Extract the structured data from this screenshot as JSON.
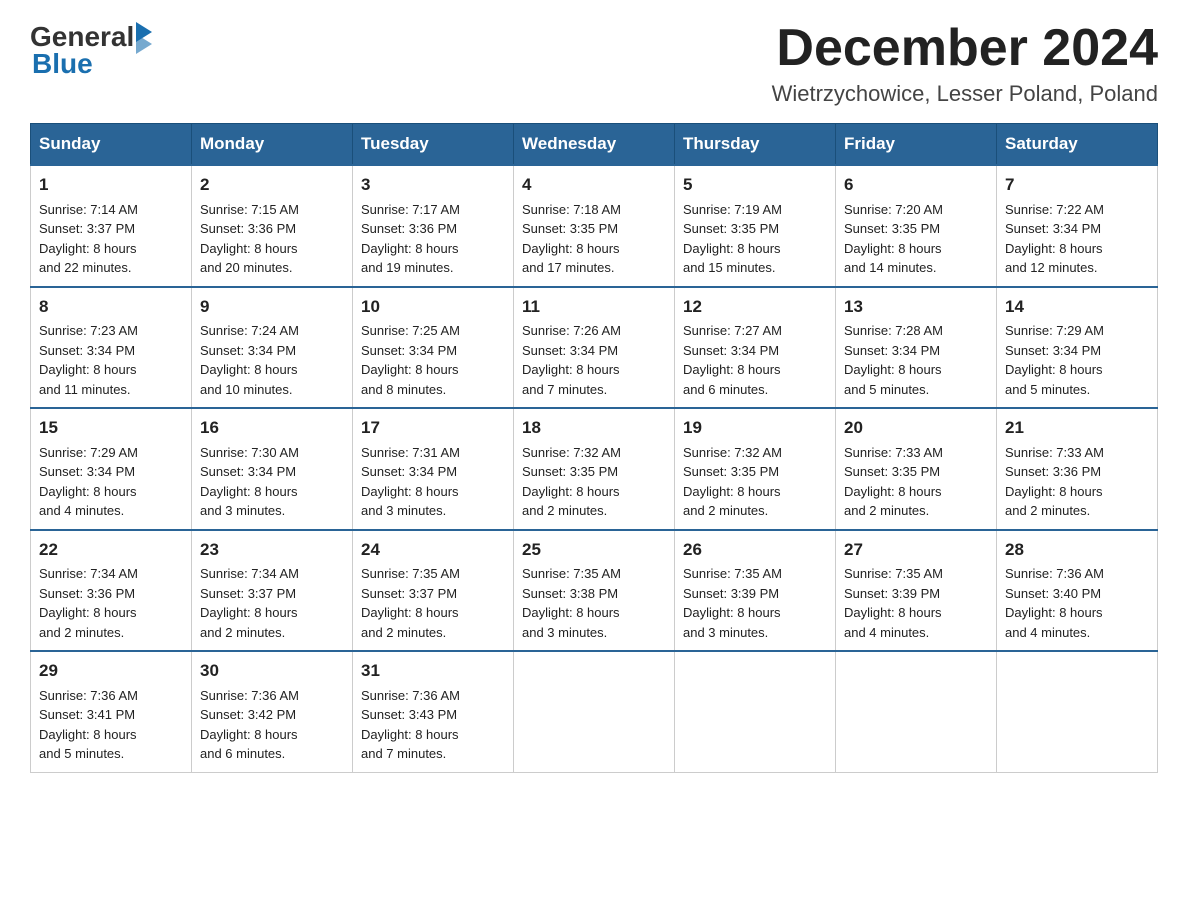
{
  "header": {
    "logo": {
      "text_general": "General",
      "text_blue": "Blue",
      "tagline": "GeneralBlue"
    },
    "title": "December 2024",
    "location": "Wietrzychowice, Lesser Poland, Poland"
  },
  "calendar": {
    "days_of_week": [
      "Sunday",
      "Monday",
      "Tuesday",
      "Wednesday",
      "Thursday",
      "Friday",
      "Saturday"
    ],
    "weeks": [
      [
        {
          "day": "1",
          "sunrise": "7:14 AM",
          "sunset": "3:37 PM",
          "daylight": "8 hours and 22 minutes."
        },
        {
          "day": "2",
          "sunrise": "7:15 AM",
          "sunset": "3:36 PM",
          "daylight": "8 hours and 20 minutes."
        },
        {
          "day": "3",
          "sunrise": "7:17 AM",
          "sunset": "3:36 PM",
          "daylight": "8 hours and 19 minutes."
        },
        {
          "day": "4",
          "sunrise": "7:18 AM",
          "sunset": "3:35 PM",
          "daylight": "8 hours and 17 minutes."
        },
        {
          "day": "5",
          "sunrise": "7:19 AM",
          "sunset": "3:35 PM",
          "daylight": "8 hours and 15 minutes."
        },
        {
          "day": "6",
          "sunrise": "7:20 AM",
          "sunset": "3:35 PM",
          "daylight": "8 hours and 14 minutes."
        },
        {
          "day": "7",
          "sunrise": "7:22 AM",
          "sunset": "3:34 PM",
          "daylight": "8 hours and 12 minutes."
        }
      ],
      [
        {
          "day": "8",
          "sunrise": "7:23 AM",
          "sunset": "3:34 PM",
          "daylight": "8 hours and 11 minutes."
        },
        {
          "day": "9",
          "sunrise": "7:24 AM",
          "sunset": "3:34 PM",
          "daylight": "8 hours and 10 minutes."
        },
        {
          "day": "10",
          "sunrise": "7:25 AM",
          "sunset": "3:34 PM",
          "daylight": "8 hours and 8 minutes."
        },
        {
          "day": "11",
          "sunrise": "7:26 AM",
          "sunset": "3:34 PM",
          "daylight": "8 hours and 7 minutes."
        },
        {
          "day": "12",
          "sunrise": "7:27 AM",
          "sunset": "3:34 PM",
          "daylight": "8 hours and 6 minutes."
        },
        {
          "day": "13",
          "sunrise": "7:28 AM",
          "sunset": "3:34 PM",
          "daylight": "8 hours and 5 minutes."
        },
        {
          "day": "14",
          "sunrise": "7:29 AM",
          "sunset": "3:34 PM",
          "daylight": "8 hours and 5 minutes."
        }
      ],
      [
        {
          "day": "15",
          "sunrise": "7:29 AM",
          "sunset": "3:34 PM",
          "daylight": "8 hours and 4 minutes."
        },
        {
          "day": "16",
          "sunrise": "7:30 AM",
          "sunset": "3:34 PM",
          "daylight": "8 hours and 3 minutes."
        },
        {
          "day": "17",
          "sunrise": "7:31 AM",
          "sunset": "3:34 PM",
          "daylight": "8 hours and 3 minutes."
        },
        {
          "day": "18",
          "sunrise": "7:32 AM",
          "sunset": "3:35 PM",
          "daylight": "8 hours and 2 minutes."
        },
        {
          "day": "19",
          "sunrise": "7:32 AM",
          "sunset": "3:35 PM",
          "daylight": "8 hours and 2 minutes."
        },
        {
          "day": "20",
          "sunrise": "7:33 AM",
          "sunset": "3:35 PM",
          "daylight": "8 hours and 2 minutes."
        },
        {
          "day": "21",
          "sunrise": "7:33 AM",
          "sunset": "3:36 PM",
          "daylight": "8 hours and 2 minutes."
        }
      ],
      [
        {
          "day": "22",
          "sunrise": "7:34 AM",
          "sunset": "3:36 PM",
          "daylight": "8 hours and 2 minutes."
        },
        {
          "day": "23",
          "sunrise": "7:34 AM",
          "sunset": "3:37 PM",
          "daylight": "8 hours and 2 minutes."
        },
        {
          "day": "24",
          "sunrise": "7:35 AM",
          "sunset": "3:37 PM",
          "daylight": "8 hours and 2 minutes."
        },
        {
          "day": "25",
          "sunrise": "7:35 AM",
          "sunset": "3:38 PM",
          "daylight": "8 hours and 3 minutes."
        },
        {
          "day": "26",
          "sunrise": "7:35 AM",
          "sunset": "3:39 PM",
          "daylight": "8 hours and 3 minutes."
        },
        {
          "day": "27",
          "sunrise": "7:35 AM",
          "sunset": "3:39 PM",
          "daylight": "8 hours and 4 minutes."
        },
        {
          "day": "28",
          "sunrise": "7:36 AM",
          "sunset": "3:40 PM",
          "daylight": "8 hours and 4 minutes."
        }
      ],
      [
        {
          "day": "29",
          "sunrise": "7:36 AM",
          "sunset": "3:41 PM",
          "daylight": "8 hours and 5 minutes."
        },
        {
          "day": "30",
          "sunrise": "7:36 AM",
          "sunset": "3:42 PM",
          "daylight": "8 hours and 6 minutes."
        },
        {
          "day": "31",
          "sunrise": "7:36 AM",
          "sunset": "3:43 PM",
          "daylight": "8 hours and 7 minutes."
        },
        null,
        null,
        null,
        null
      ]
    ]
  }
}
